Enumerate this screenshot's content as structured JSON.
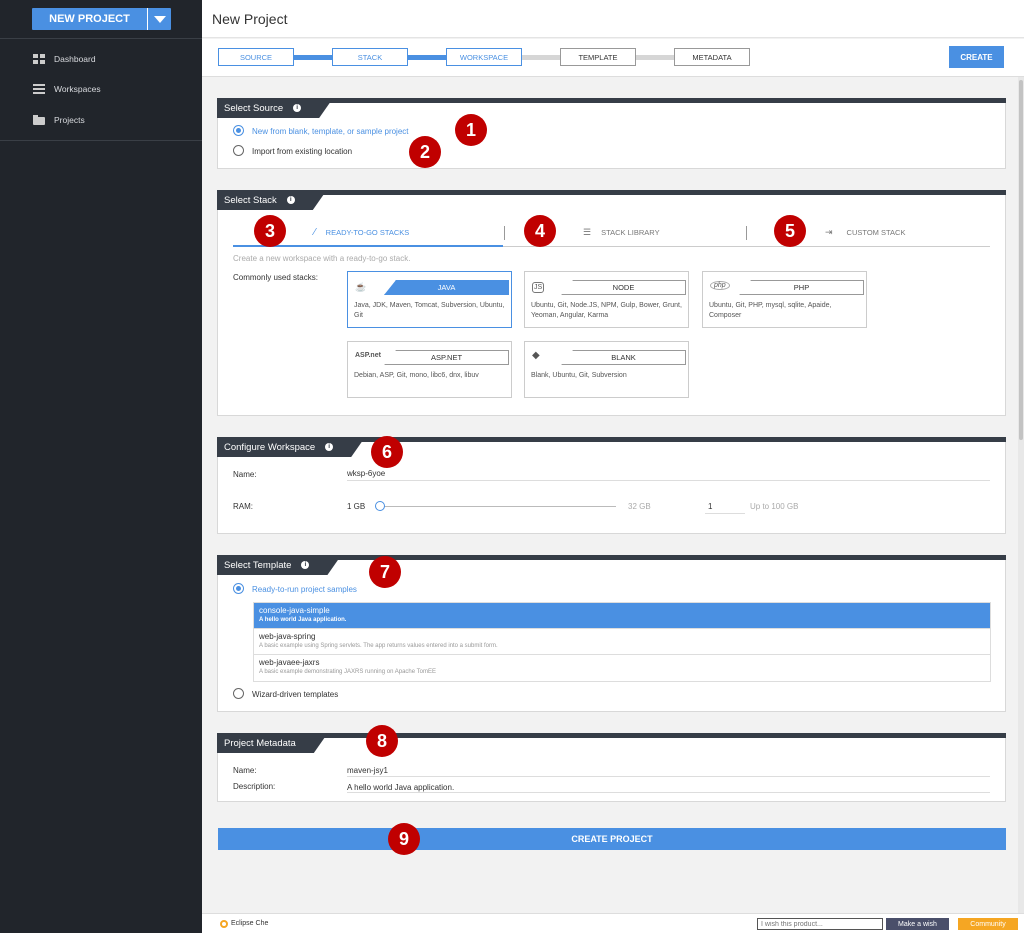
{
  "sidebar": {
    "new_project_label": "NEW PROJECT",
    "items": [
      {
        "label": "Dashboard",
        "icon": "dashboard-icon"
      },
      {
        "label": "Workspaces",
        "icon": "workspaces-icon"
      },
      {
        "label": "Projects",
        "icon": "folder-icon"
      }
    ]
  },
  "header": {
    "title": "New Project"
  },
  "steps": [
    "SOURCE",
    "STACK",
    "WORKSPACE",
    "TEMPLATE",
    "METADATA"
  ],
  "create_label": "CREATE",
  "source": {
    "title": "Select Source",
    "opt1": "New from blank, template, or sample project",
    "opt2": "Import from existing location"
  },
  "stack": {
    "title": "Select Stack",
    "tabs": [
      "READY-TO-GO STACKS",
      "STACK LIBRARY",
      "CUSTOM STACK"
    ],
    "hint": "Create a new workspace with a ready-to-go stack.",
    "common_label": "Commonly used stacks:",
    "cards": [
      {
        "name": "JAVA",
        "logo": "",
        "desc": "Java, JDK, Maven, Tomcat, Subversion, Ubuntu, Git"
      },
      {
        "name": "NODE",
        "logo": "JS",
        "desc": "Ubuntu, Git, Node.JS, NPM, Gulp, Bower, Grunt, Yeoman, Angular, Karma"
      },
      {
        "name": "PHP",
        "logo": "php",
        "desc": "Ubuntu, Git, PHP, mysql, sqlite, Apaide, Composer"
      },
      {
        "name": "ASP.NET",
        "logo": "ASP.net",
        "desc": "Debian, ASP, Git, mono, libc6, dnx, libuv"
      },
      {
        "name": "BLANK",
        "logo": "",
        "desc": "Blank, Ubuntu, Git, Subversion"
      }
    ]
  },
  "workspace": {
    "title": "Configure Workspace",
    "name_label": "Name:",
    "name_value": "wksp-6yoe",
    "ram_label": "RAM:",
    "ram_min": "1 GB",
    "ram_max": "32 GB",
    "ram_value": "1",
    "ram_limit": "Up to 100 GB"
  },
  "template": {
    "title": "Select Template",
    "opt1": "Ready-to-run project samples",
    "opt2": "Wizard-driven templates",
    "items": [
      {
        "name": "console-java-simple",
        "desc": "A hello world Java application."
      },
      {
        "name": "web-java-spring",
        "desc": "A basic example using Spring servlets. The app returns values entered into a submit form."
      },
      {
        "name": "web-javaee-jaxrs",
        "desc": "A basic example demonstrating JAXRS running on Apache TomEE"
      }
    ]
  },
  "metadata": {
    "title": "Project Metadata",
    "name_label": "Name:",
    "name_value": "maven-jsy1",
    "desc_label": "Description:",
    "desc_value": "A hello world Java application."
  },
  "create_project_label": "CREATE PROJECT",
  "footer": {
    "brand": "Eclipse Che",
    "wish_placeholder": "I wish this product...",
    "wish_button": "Make a wish",
    "community": "Community"
  },
  "badges": [
    "1",
    "2",
    "3",
    "4",
    "5",
    "6",
    "7",
    "8",
    "9"
  ],
  "colors": {
    "accent": "#4a90e2",
    "sidebar": "#21252b",
    "panel_header": "#363d47",
    "badge": "#c00000",
    "community": "#f5a623"
  }
}
